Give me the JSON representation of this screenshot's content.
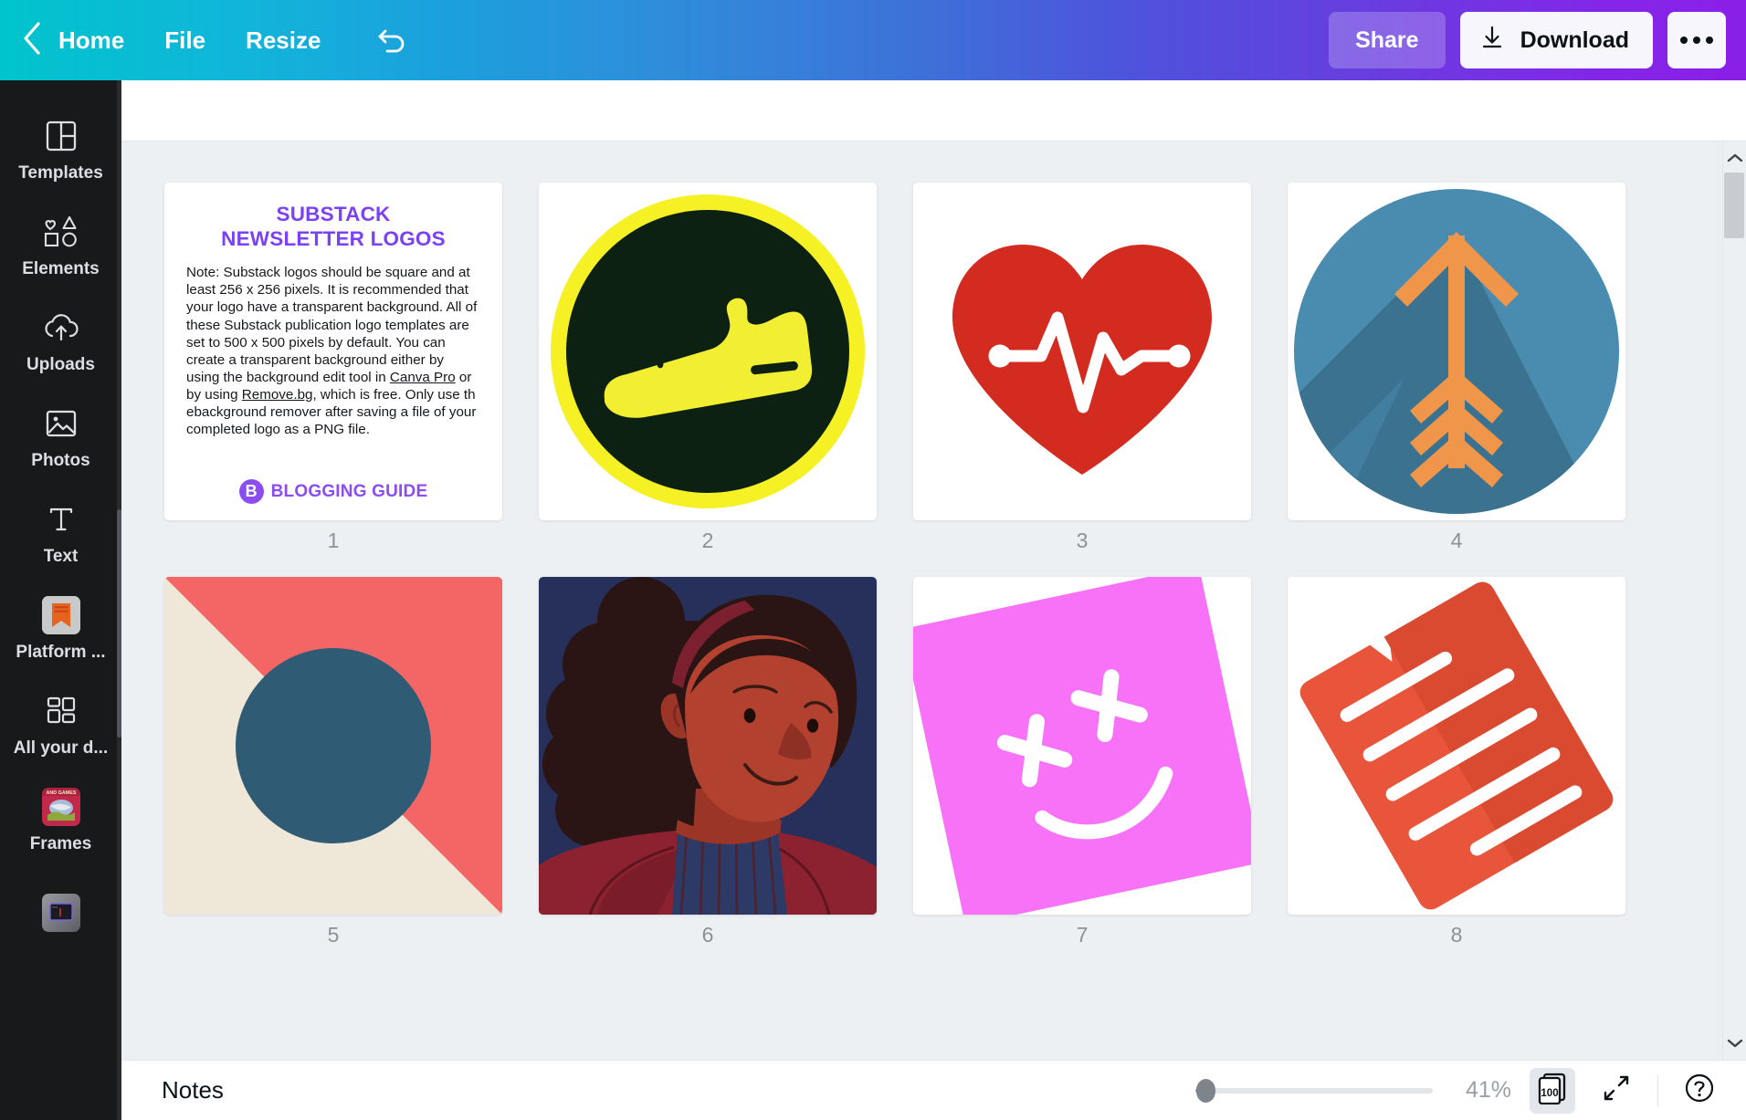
{
  "header": {
    "back_icon": "chevron-left-icon",
    "home_label": "Home",
    "file_label": "File",
    "resize_label": "Resize",
    "undo_icon": "undo-icon",
    "share_label": "Share",
    "download_label": "Download",
    "download_icon": "download-icon",
    "more_icon": "more-horizontal-icon",
    "gradient_start": "#00C4CC",
    "gradient_end": "#8B1FE8"
  },
  "sidebar": {
    "items": [
      {
        "label": "Templates",
        "icon": "templates-icon"
      },
      {
        "label": "Elements",
        "icon": "elements-icon"
      },
      {
        "label": "Uploads",
        "icon": "uploads-icon"
      },
      {
        "label": "Photos",
        "icon": "photos-icon"
      },
      {
        "label": "Text",
        "icon": "text-icon"
      },
      {
        "label": "Platform ...",
        "icon": "platform-bookmark-icon"
      },
      {
        "label": "All your d...",
        "icon": "grid-icon"
      },
      {
        "label": "Frames",
        "icon": "frames-thumbnail-icon"
      },
      {
        "label": "",
        "icon": "video-thumbnail-icon"
      }
    ],
    "background": "#18191B"
  },
  "canvas": {
    "pages": [
      {
        "number": "1",
        "type": "text-page",
        "title_line1": "SUBSTACK",
        "title_line2": "NEWSLETTER LOGOS",
        "title_color": "#7B41F5",
        "body_before_canva": "Note: Substack logos should be square and at least 256 x 256 pixels. It is recommended that your logo have a transparent background. All of these Substack publication logo templates are set to 500 x 500 pixels by default. You can create a transparent background either by using the background edit tool in ",
        "link_canva": "Canva Pro",
        "body_mid": " or by using ",
        "link_removebg": "Remove.bg",
        "body_after": ", which is free. Only use th ebackground remover after saving a file of your completed logo as a PNG file.",
        "brand_mark": "B",
        "brand_name": "BLOGGING GUIDE",
        "brand_color": "#8B4DF2"
      },
      {
        "number": "2",
        "type": "sneaker-badge",
        "ring_color": "#F5F125",
        "disc_color": "#0D2113",
        "shoe_color": "#F2EF33"
      },
      {
        "number": "3",
        "type": "heartbeat-heart",
        "heart_color": "#D32B20",
        "line_color": "#FFFFFF",
        "bg_color": "#FFFFFF"
      },
      {
        "number": "4",
        "type": "arrow-circle",
        "circle_color": "#4A8CB0",
        "shadow_color": "#3B7290",
        "arrow_color": "#F0964B"
      },
      {
        "number": "5",
        "type": "diagonal-circle",
        "cream_color": "#EFE8D8",
        "coral_color": "#F46565",
        "circle_color": "#2F5B75"
      },
      {
        "number": "6",
        "type": "portrait",
        "bg_color": "#26305A",
        "hair_color": "#2B1414",
        "skin_color": "#B2412F",
        "jacket_color": "#8C2230",
        "sweater_color": "#2E3A66"
      },
      {
        "number": "7",
        "type": "smiley-square",
        "square_color": "#F872F8",
        "face_color": "#FFFFFF",
        "rotation": "-12deg"
      },
      {
        "number": "8",
        "type": "document-lines",
        "doc_color": "#E8553A",
        "doc_shadow": "#DA4A30",
        "line_color": "#FFFFFF",
        "rotation": "-30deg"
      }
    ]
  },
  "bottombar": {
    "notes_label": "Notes",
    "zoom_value": "41%",
    "zoom_slider_position": 0,
    "page_count_label": "100",
    "page_count_icon": "page-count-icon",
    "fullscreen_icon": "expand-icon",
    "help_icon": "help-circle-icon"
  }
}
